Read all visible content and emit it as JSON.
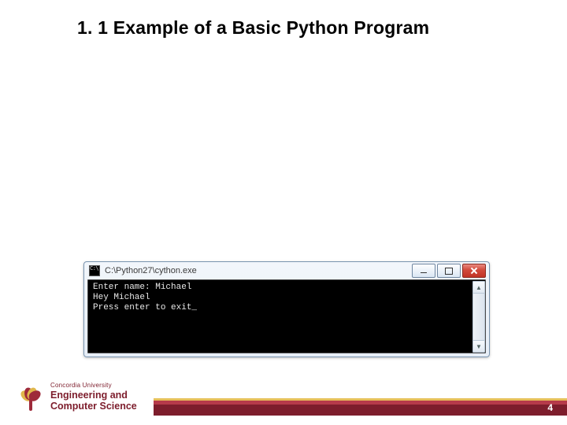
{
  "slide": {
    "title": "1. 1 Example of a Basic Python Program",
    "page_number": "4"
  },
  "console": {
    "window_title": "C:\\Python27\\cython.exe",
    "lines": {
      "l1": "Enter name: Michael",
      "l2": "Hey Michael",
      "l3": "Press enter to exit"
    }
  },
  "brand": {
    "university": "Concordia University",
    "dept_line1": "Engineering and",
    "dept_line2": "Computer Science"
  }
}
